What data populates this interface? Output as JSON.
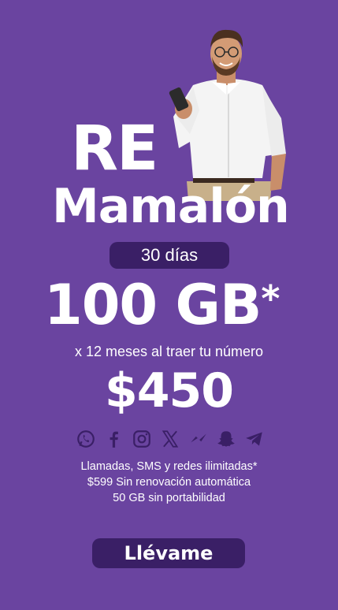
{
  "promo": {
    "title_line1": "RE",
    "title_line2": "Mamalón",
    "duration_label": "30 días",
    "data_amount": "100 GB",
    "data_asterisk": "*",
    "subtitle": "x 12 meses al traer tu número",
    "price": "$450",
    "details": [
      "Llamadas, SMS y redes ilimitadas*",
      "$599 Sin renovación automática",
      "50 GB sin portabilidad"
    ],
    "cta_label": "Llévame"
  },
  "social_icons": [
    "whatsapp-icon",
    "facebook-icon",
    "instagram-icon",
    "x-icon",
    "messenger-icon",
    "snapchat-icon",
    "telegram-icon"
  ],
  "colors": {
    "background": "#6a44a0",
    "pill": "#3a1f66",
    "text": "#ffffff"
  }
}
